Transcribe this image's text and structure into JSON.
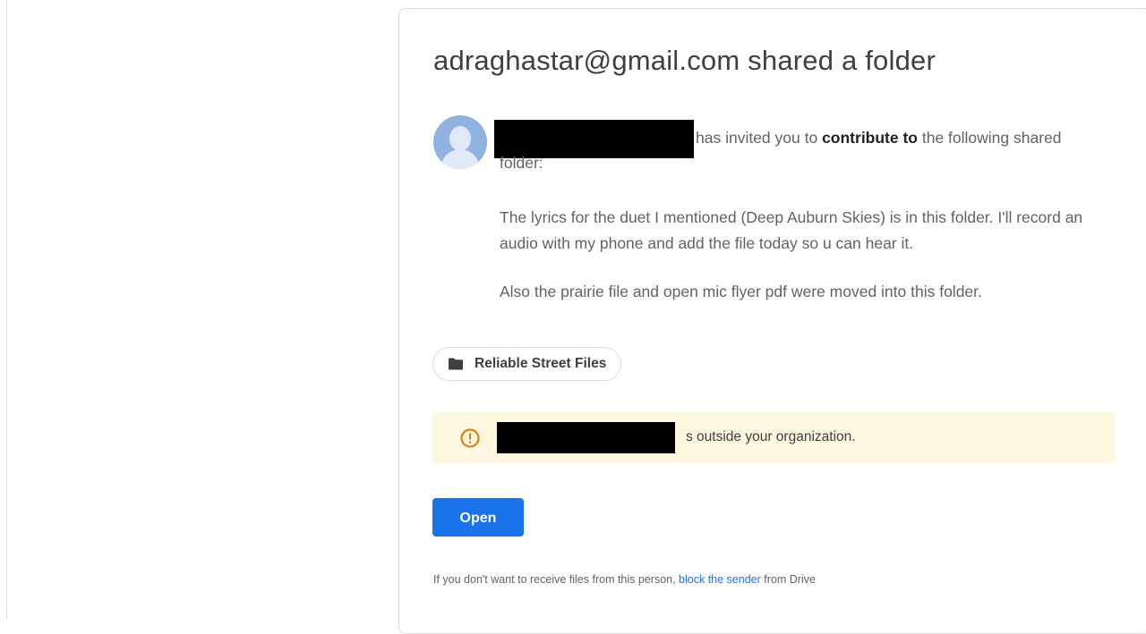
{
  "email": {
    "title": "adraghastar@gmail.com shared a folder",
    "invite": {
      "text_before_bold": "has invited you to ",
      "bold": "contribute to",
      "text_after_bold": " the following shared",
      "continuation": "folder:"
    },
    "message": {
      "paragraph_1": "The lyrics for the duet I mentioned (Deep Auburn Skies) is in this folder. I'll record an audio with my phone and add the file today so u can hear it.",
      "paragraph_2": "Also the prairie file and open mic flyer pdf were moved into this folder."
    },
    "folder_chip": {
      "label": "Reliable Street Files",
      "icon": "folder-icon"
    },
    "warning_banner": {
      "icon": "warning-icon",
      "text": "s outside your organization."
    },
    "open_button": {
      "label": "Open"
    },
    "footer": {
      "text_before_link": "If you don't want to receive files from this person, ",
      "link_text": "block the sender",
      "text_after_link": " from Drive"
    }
  },
  "colors": {
    "primary_button": "#1a73e8",
    "banner_background": "#fef7e0",
    "warning_icon": "#e37400",
    "link": "#1a73e8",
    "avatar": "#8fb2e0"
  }
}
